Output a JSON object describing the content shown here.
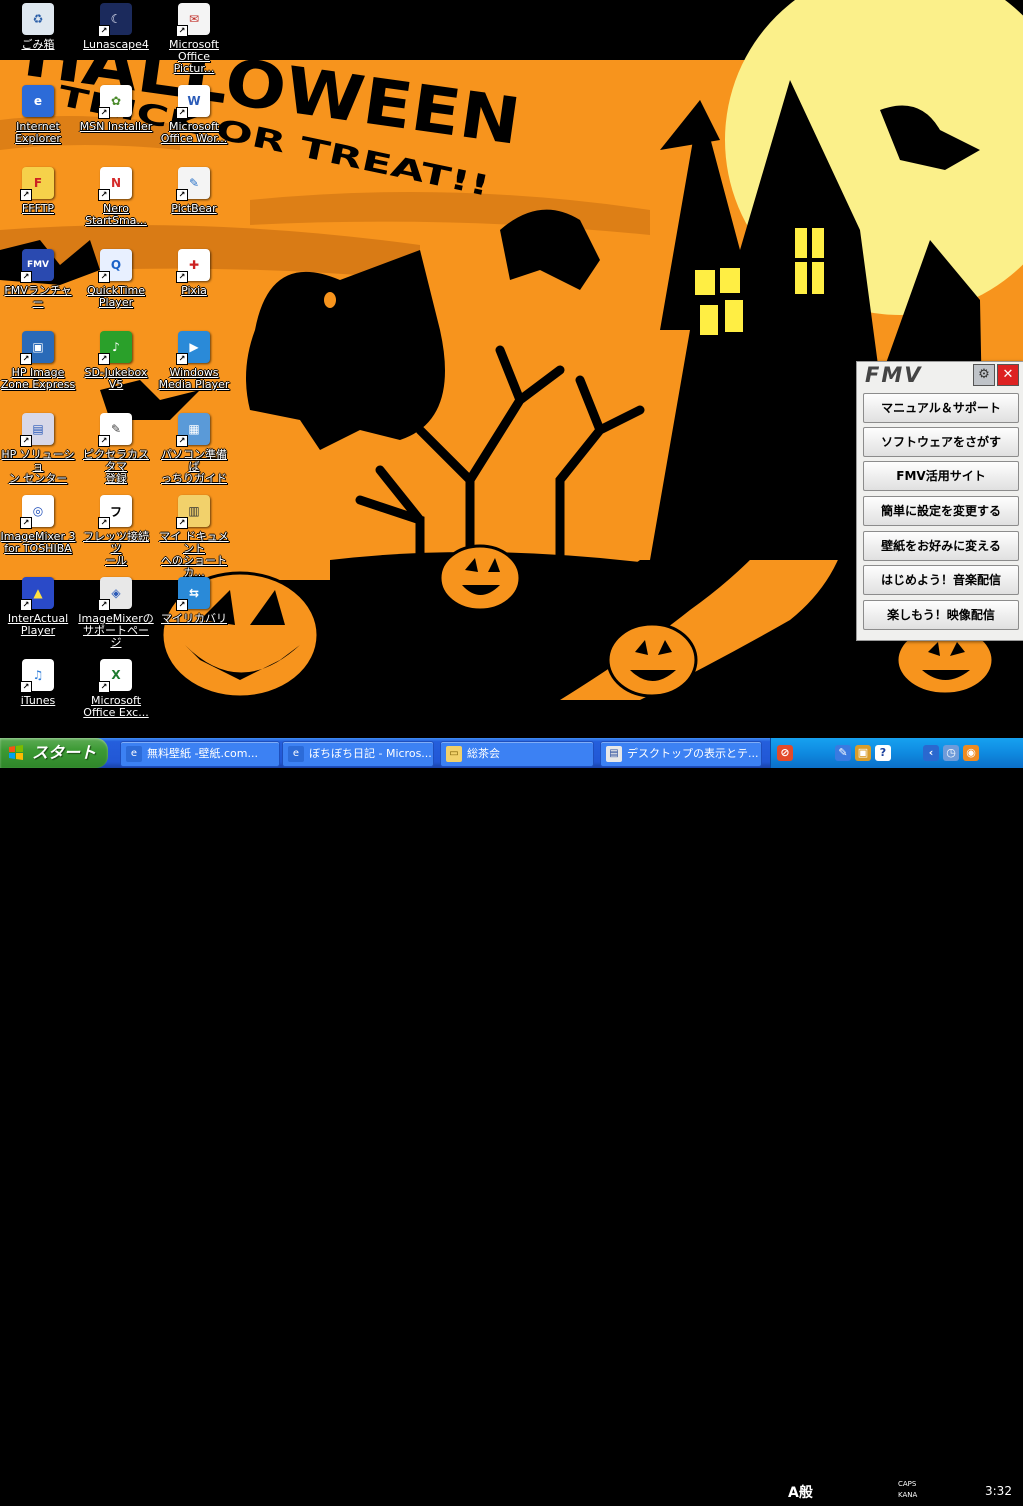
{
  "colors": {
    "wallpaper_orange": "#f7941d",
    "taskbar_blue": "#245edc",
    "start_green": "#3c9a34",
    "tray_blue": "#0f8ae0",
    "window_glow": "#ffee44"
  },
  "wallpaper": {
    "title": "HALLOWEEN",
    "subtitle": "TRICK OR TREAT!!"
  },
  "desktop_icons": [
    {
      "label": "ごみ箱",
      "icon": "recycle-bin-icon",
      "shortcut": false
    },
    {
      "label": "Lunascape4",
      "icon": "lunascape-icon",
      "shortcut": true
    },
    {
      "label": "Microsoft\nOffice Pictur...",
      "icon": "office-picture-manager-icon",
      "shortcut": true
    },
    {
      "label": "Internet\nExplorer",
      "icon": "internet-explorer-icon",
      "shortcut": false
    },
    {
      "label": "MSN Installer",
      "icon": "msn-icon",
      "shortcut": true
    },
    {
      "label": "Microsoft\nOffice Wor...",
      "icon": "word-icon",
      "shortcut": true
    },
    {
      "label": "FFFTP",
      "icon": "ffftp-icon",
      "shortcut": true
    },
    {
      "label": "Nero\nStartSma...",
      "icon": "nero-icon",
      "shortcut": true
    },
    {
      "label": "PictBear",
      "icon": "pictbear-icon",
      "shortcut": true
    },
    {
      "label": "FMVランチャー",
      "icon": "fmv-launcher-icon",
      "shortcut": true
    },
    {
      "label": "QuickTime\nPlayer",
      "icon": "quicktime-icon",
      "shortcut": true
    },
    {
      "label": "Pixia",
      "icon": "pixia-icon",
      "shortcut": true
    },
    {
      "label": "HP Image\nZone Express",
      "icon": "hp-image-zone-icon",
      "shortcut": true
    },
    {
      "label": "SD-Jukebox\nV5",
      "icon": "sd-jukebox-icon",
      "shortcut": true
    },
    {
      "label": "Windows\nMedia Player",
      "icon": "media-player-icon",
      "shortcut": true
    },
    {
      "label": "HP ソリューショ\nン センター",
      "icon": "hp-solution-center-icon",
      "shortcut": true
    },
    {
      "label": "ピクセラカスタマ\n登録",
      "icon": "pixela-registration-icon",
      "shortcut": true
    },
    {
      "label": "パソコン準備ば\nっちりガイド",
      "icon": "pc-guide-icon",
      "shortcut": true
    },
    {
      "label": "ImageMixer 3\nfor TOSHIBA",
      "icon": "imagemixer-icon",
      "shortcut": true
    },
    {
      "label": "フレッツ接続ツ\nール",
      "icon": "flets-icon",
      "shortcut": true
    },
    {
      "label": "マイ ドキュメント\nへのショートカ...",
      "icon": "my-documents-icon",
      "shortcut": true
    },
    {
      "label": "InterActual\nPlayer",
      "icon": "interactual-icon",
      "shortcut": true
    },
    {
      "label": "ImageMixerの\nサポートページ",
      "icon": "imagemixer-support-icon",
      "shortcut": true
    },
    {
      "label": "マイリカバリ",
      "icon": "my-recovery-icon",
      "shortcut": true
    },
    {
      "label": "iTunes",
      "icon": "itunes-icon",
      "shortcut": true
    },
    {
      "label": "Microsoft\nOffice Exc...",
      "icon": "excel-icon",
      "shortcut": true
    }
  ],
  "fmv_panel": {
    "logo": "FMV",
    "settings_icon": "wrench-icon",
    "close_icon": "close-icon",
    "items": [
      "マニュアル＆サポート",
      "ソフトウェアをさがす",
      "FMV活用サイト",
      "簡単に設定を変更する",
      "壁紙をお好みに変える",
      "はじめよう！音楽配信",
      "楽しもう！映像配信"
    ]
  },
  "taskbar": {
    "start_label": "スタート",
    "tasks": [
      {
        "label": "無料壁紙 -壁紙.com...",
        "icon": "ie-window-icon"
      },
      {
        "label": "ぼちぼち日記 - Micros...",
        "icon": "ie-window-icon"
      },
      {
        "label": "総茶会",
        "icon": "folder-icon"
      },
      {
        "label": "デスクトップの表示とテ...",
        "icon": "document-icon"
      }
    ],
    "ime": "A般",
    "caps": "CAPS",
    "kana": "KANA",
    "clock": "3:32"
  }
}
